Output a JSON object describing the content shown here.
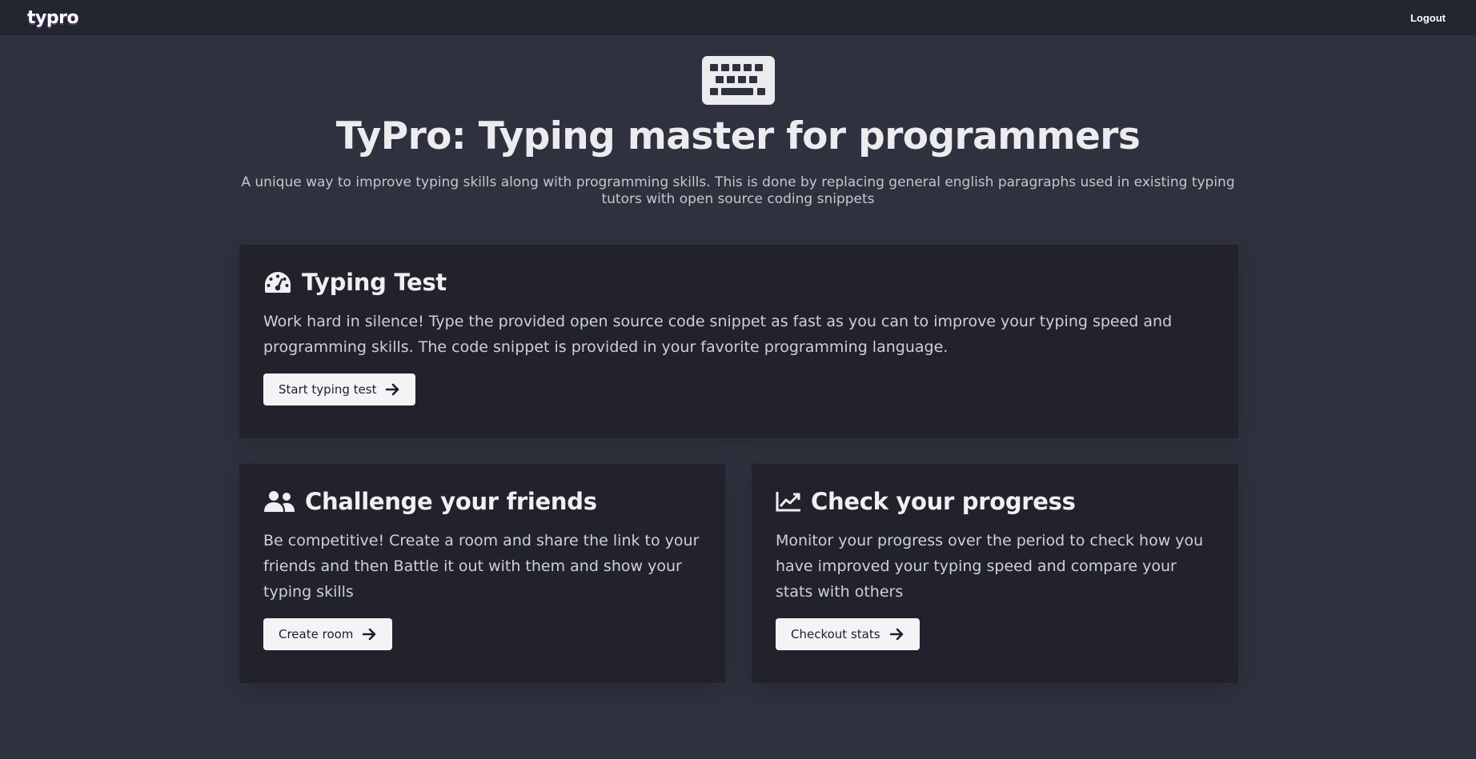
{
  "navbar": {
    "brand": "typro",
    "logout_label": "Logout"
  },
  "hero": {
    "icon": "keyboard-icon",
    "title": "TyPro: Typing master for programmers",
    "subtitle": "A unique way to improve typing skills along with programming skills. This is done by replacing general english paragraphs used in existing typing tutors with open source coding snippets"
  },
  "cards": {
    "typing_test": {
      "icon": "speedometer-icon",
      "title": "Typing Test",
      "text": "Work hard in silence! Type the provided open source code snippet as fast as you can to improve your typing speed and programming skills. The code snippet is provided in your favorite programming language.",
      "button_label": "Start typing test"
    },
    "challenge": {
      "icon": "users-icon",
      "title": "Challenge your friends",
      "text": "Be competitive! Create a room and share the link to your friends and then Battle it out with them and show your typing skills",
      "button_label": "Create room"
    },
    "progress": {
      "icon": "chart-line-icon",
      "title": "Check your progress",
      "text": "Monitor your progress over the period to check how you have improved your typing speed and compare your stats with others",
      "button_label": "Checkout stats"
    }
  },
  "colors": {
    "page_bg": "#2e323e",
    "navbar_bg": "#23252f",
    "card_bg": "#21222b",
    "button_bg": "#f4f4f6"
  }
}
